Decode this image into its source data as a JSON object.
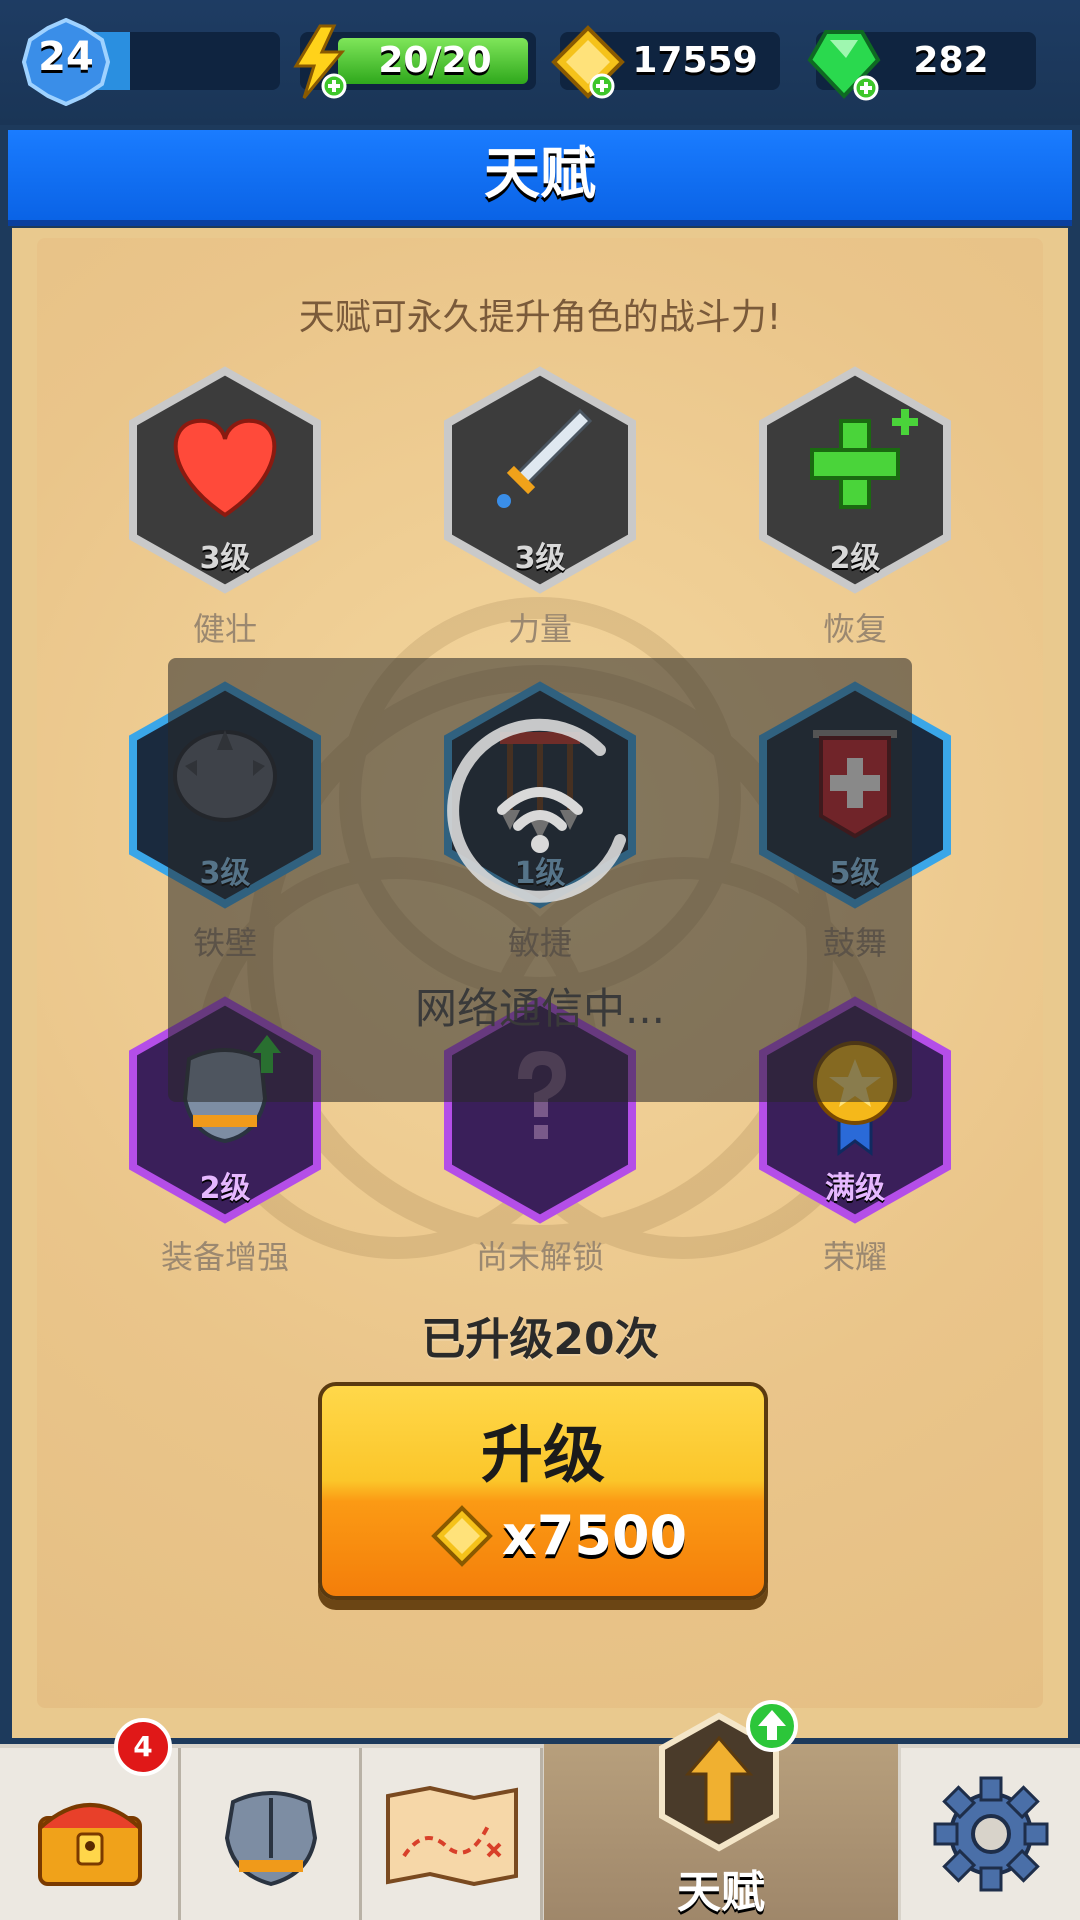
{
  "hud": {
    "player_level": "24",
    "energy": "20/20",
    "gold": "17559",
    "gems": "282"
  },
  "header": {
    "title": "天赋"
  },
  "panel": {
    "subtitle": "天赋可永久提升角色的战斗力!"
  },
  "talents": [
    {
      "name": "健壮",
      "level": "3级",
      "icon": "heart-icon"
    },
    {
      "name": "力量",
      "level": "3级",
      "icon": "sword-icon"
    },
    {
      "name": "恢复",
      "level": "2级",
      "icon": "plus-icon"
    },
    {
      "name": "铁壁",
      "level": "3级",
      "icon": "shield-icon"
    },
    {
      "name": "敏捷",
      "level": "1级",
      "icon": "arrows-icon"
    },
    {
      "name": "鼓舞",
      "level": "5级",
      "icon": "banner-icon"
    },
    {
      "name": "装备增强",
      "level": "2级",
      "icon": "armor-icon"
    },
    {
      "name": "尚未解锁",
      "level": "",
      "icon": "question-icon"
    },
    {
      "name": "荣耀",
      "level": "满级",
      "icon": "medal-icon"
    }
  ],
  "loading": {
    "text": "网络通信中..."
  },
  "upgrade": {
    "count_text": "已升级20次",
    "button_label": "升级",
    "cost": "x7500"
  },
  "nav": {
    "chest_badge": "4",
    "active_label": "天赋"
  },
  "colors": {
    "hud_blue": "#1e3c63",
    "title_blue": "#1a7cff",
    "energy_green": "#3ec62a",
    "gem_green": "#2ad94e",
    "gold": "#f5c21a",
    "tier1": "#c9c9c9",
    "tier2": "#3aa6e8",
    "tier3": "#b44ee8"
  }
}
